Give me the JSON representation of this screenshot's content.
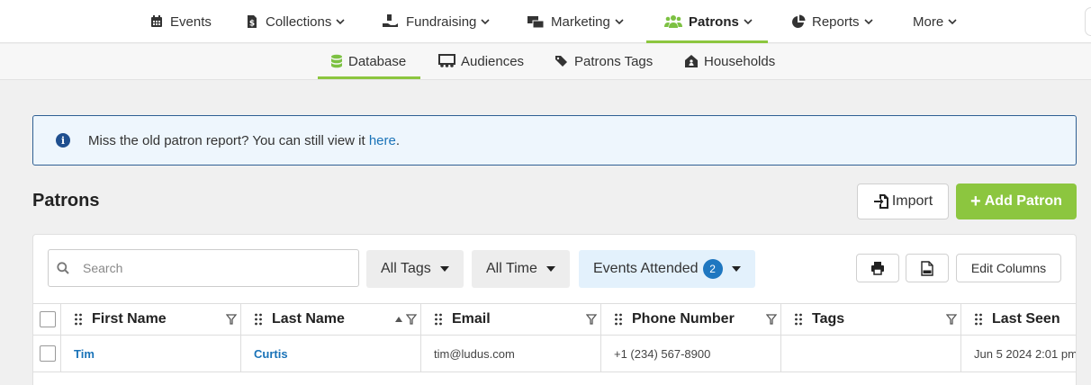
{
  "top_nav": {
    "items": [
      {
        "label": "Events",
        "icon": "calendar-icon",
        "has_menu": false
      },
      {
        "label": "Collections",
        "icon": "invoice-dollar-icon",
        "has_menu": true
      },
      {
        "label": "Fundraising",
        "icon": "hand-donate-icon",
        "has_menu": true
      },
      {
        "label": "Marketing",
        "icon": "mail-bulk-icon",
        "has_menu": true
      },
      {
        "label": "Patrons",
        "icon": "users-icon",
        "has_menu": true,
        "active": true
      },
      {
        "label": "Reports",
        "icon": "pie-chart-icon",
        "has_menu": true
      },
      {
        "label": "More",
        "icon": "",
        "has_menu": true
      }
    ]
  },
  "sub_nav": {
    "items": [
      {
        "label": "Database",
        "icon": "database-icon",
        "active": true
      },
      {
        "label": "Audiences",
        "icon": "audience-icon"
      },
      {
        "label": "Patrons Tags",
        "icon": "tags-icon"
      },
      {
        "label": "Households",
        "icon": "house-icon"
      }
    ]
  },
  "banner": {
    "text": "Miss the old patron report? You can still view it ",
    "link_text": "here",
    "suffix": "."
  },
  "header": {
    "title": "Patrons",
    "import_label": "Import",
    "add_label": "Add Patron"
  },
  "toolbar": {
    "search_placeholder": "Search",
    "filters": [
      {
        "label": "All Tags"
      },
      {
        "label": "All Time"
      },
      {
        "label": "Events Attended",
        "count": "2"
      }
    ],
    "edit_columns_label": "Edit Columns"
  },
  "table": {
    "columns": [
      "First Name",
      "Last Name",
      "Email",
      "Phone Number",
      "Tags",
      "Last Seen"
    ],
    "sorted_column": "Last Name",
    "sort_direction": "ascending",
    "rows": [
      {
        "first_name": "Tim",
        "last_name": "Curtis",
        "email": "tim@ludus.com",
        "phone": "+1 (234) 567-8900",
        "tags": "",
        "last_seen": "Jun 5 2024 2:01 pm"
      }
    ]
  },
  "colors": {
    "accent_green": "#8cc63f",
    "link_blue": "#1a73b8",
    "banner_border": "#2f5f93",
    "badge_blue": "#1f77c0"
  }
}
